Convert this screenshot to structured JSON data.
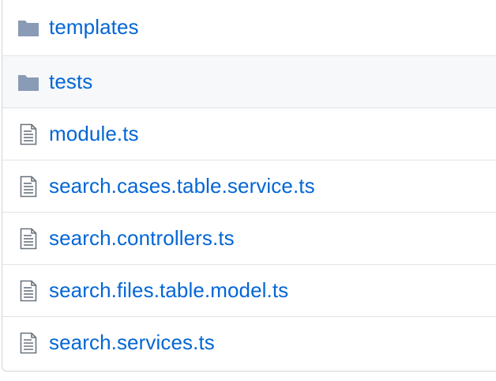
{
  "colors": {
    "link": "#0366d6",
    "folder_icon": "#79b8ff",
    "file_icon": "#6a737d",
    "row_hover": "#f6f8fa",
    "border": "#e1e4e8"
  },
  "entries": [
    {
      "name": "templates",
      "type": "folder",
      "icon": "folder-icon"
    },
    {
      "name": "tests",
      "type": "folder",
      "icon": "folder-icon"
    },
    {
      "name": "module.ts",
      "type": "file",
      "icon": "file-icon"
    },
    {
      "name": "search.cases.table.service.ts",
      "type": "file",
      "icon": "file-icon"
    },
    {
      "name": "search.controllers.ts",
      "type": "file",
      "icon": "file-icon"
    },
    {
      "name": "search.files.table.model.ts",
      "type": "file",
      "icon": "file-icon"
    },
    {
      "name": "search.services.ts",
      "type": "file",
      "icon": "file-icon"
    }
  ]
}
